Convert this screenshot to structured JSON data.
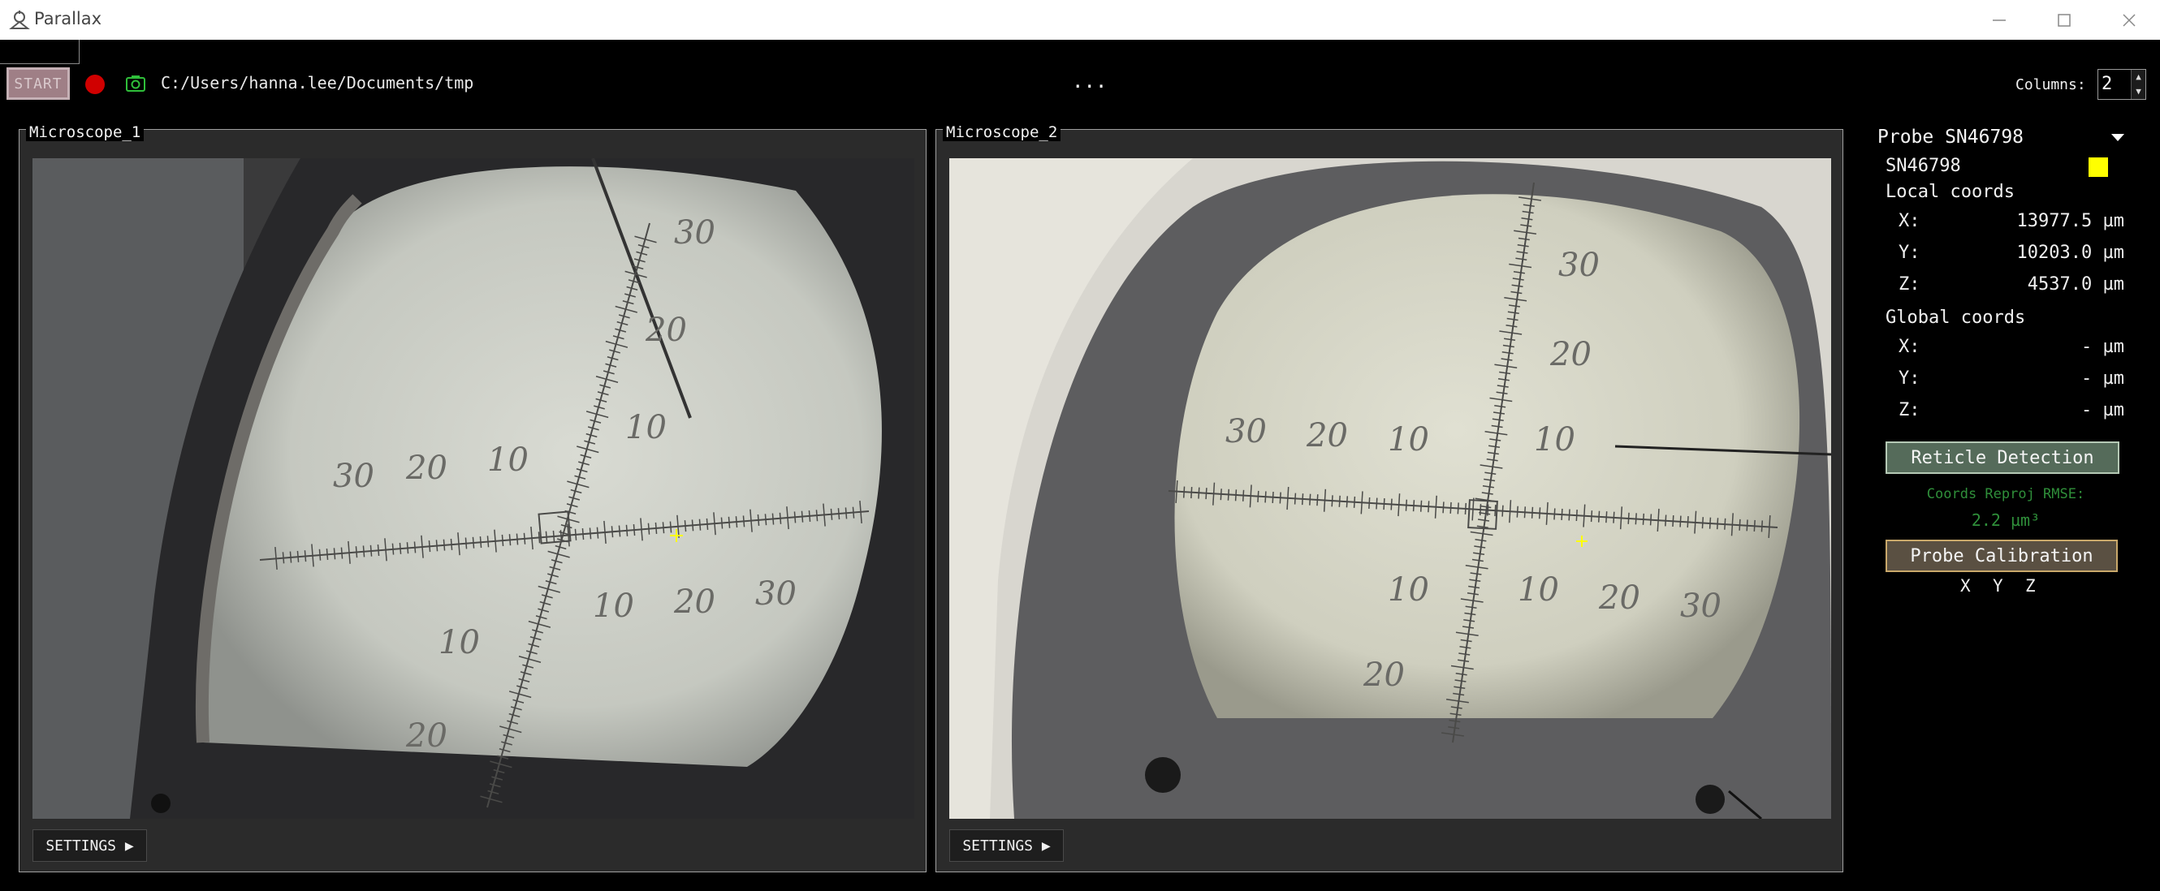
{
  "window": {
    "title": "Parallax"
  },
  "toolbar": {
    "start_label": "START",
    "directory": "C:/Users/hanna.lee/Documents/tmp",
    "browse_label": "...",
    "columns_label": "Columns:",
    "columns_value": "2"
  },
  "microscopes": [
    {
      "title": "Microscope_1",
      "settings_label": "SETTINGS ▶"
    },
    {
      "title": "Microscope_2",
      "settings_label": "SETTINGS ▶"
    }
  ],
  "probe_panel": {
    "selected_probe": "Probe SN46798",
    "probe_id": "SN46798",
    "probe_color": "#ffff00",
    "local_label": "Local coords",
    "local": {
      "x_label": "X:",
      "x_value": "13977.5 µm",
      "y_label": "Y:",
      "y_value": "10203.0 µm",
      "z_label": "Z:",
      "z_value": "4537.0 µm"
    },
    "global_label": "Global coords",
    "global": {
      "x_label": "X:",
      "x_value": "- µm",
      "y_label": "Y:",
      "y_value": "- µm",
      "z_label": "Z:",
      "z_value": "- µm"
    },
    "reticle_button": "Reticle Detection",
    "rmse_label": "Coords Reproj RMSE:",
    "rmse_value": "2.2 µm³",
    "probe_cal_button": "Probe Calibration",
    "axes": {
      "x": "X",
      "y": "Y",
      "z": "Z"
    }
  },
  "reticle_numbers": [
    "30",
    "20",
    "10"
  ],
  "colors": {
    "record": "#d00000",
    "snapshot": "#2fbf3a",
    "reticle_button": "#556b5a",
    "probe_cal_button": "#5a5042",
    "rmse_text": "#2f8f3a"
  }
}
